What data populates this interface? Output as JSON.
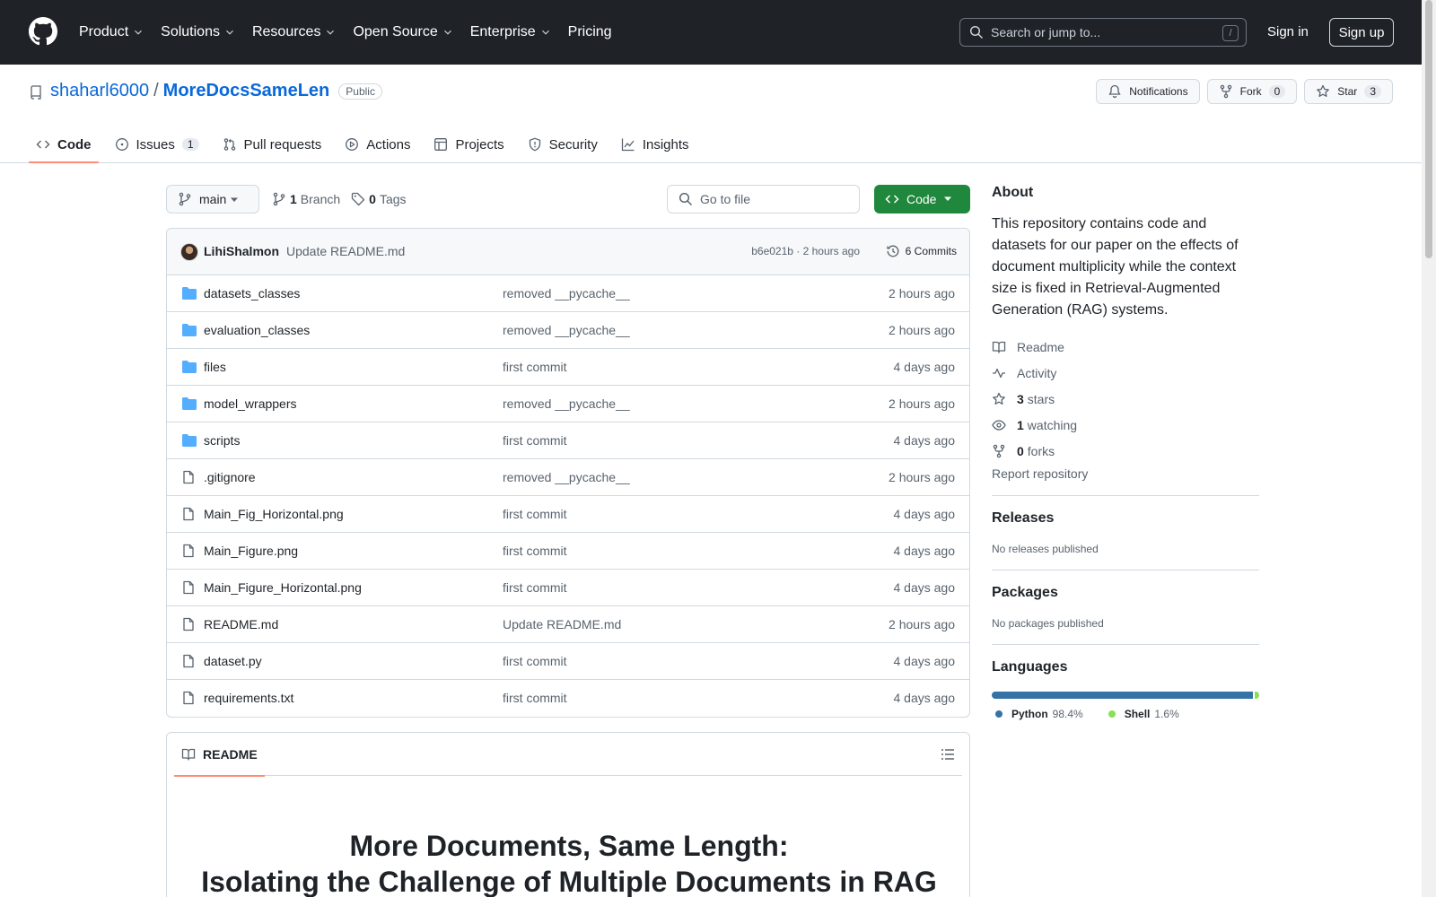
{
  "header": {
    "nav": [
      {
        "label": "Product",
        "dropdown": true
      },
      {
        "label": "Solutions",
        "dropdown": true
      },
      {
        "label": "Resources",
        "dropdown": true
      },
      {
        "label": "Open Source",
        "dropdown": true
      },
      {
        "label": "Enterprise",
        "dropdown": true
      },
      {
        "label": "Pricing",
        "dropdown": false
      }
    ],
    "search_placeholder": "Search or jump to...",
    "search_shortcut": "/",
    "sign_in": "Sign in",
    "sign_up": "Sign up"
  },
  "repo": {
    "owner": "shaharl6000",
    "separator": "/",
    "name": "MoreDocsSameLen",
    "visibility": "Public",
    "notifications_label": "Notifications",
    "fork_label": "Fork",
    "fork_count": "0",
    "star_label": "Star",
    "star_count": "3"
  },
  "tabs": [
    {
      "label": "Code",
      "icon": "code-icon",
      "active": true
    },
    {
      "label": "Issues",
      "icon": "issue-icon",
      "count": "1"
    },
    {
      "label": "Pull requests",
      "icon": "pull-request-icon"
    },
    {
      "label": "Actions",
      "icon": "play-icon"
    },
    {
      "label": "Projects",
      "icon": "table-icon"
    },
    {
      "label": "Security",
      "icon": "shield-icon"
    },
    {
      "label": "Insights",
      "icon": "graph-icon"
    }
  ],
  "filebar": {
    "branch": "main",
    "branch_count": "1",
    "branch_label": "Branch",
    "tag_count": "0",
    "tag_label": "Tags",
    "goto_placeholder": "Go to file",
    "code_button": "Code"
  },
  "latest_commit": {
    "author": "LihiShalmon",
    "message": "Update README.md",
    "meta": "b6e021b · 2 hours ago",
    "commits_label": "6 Commits"
  },
  "files": [
    {
      "type": "dir",
      "name": "datasets_classes",
      "message": "removed __pycache__",
      "age": "2 hours ago"
    },
    {
      "type": "dir",
      "name": "evaluation_classes",
      "message": "removed __pycache__",
      "age": "2 hours ago"
    },
    {
      "type": "dir",
      "name": "files",
      "message": "first commit",
      "age": "4 days ago"
    },
    {
      "type": "dir",
      "name": "model_wrappers",
      "message": "removed __pycache__",
      "age": "2 hours ago"
    },
    {
      "type": "dir",
      "name": "scripts",
      "message": "first commit",
      "age": "4 days ago"
    },
    {
      "type": "file",
      "name": ".gitignore",
      "message": "removed __pycache__",
      "age": "2 hours ago"
    },
    {
      "type": "file",
      "name": "Main_Fig_Horizontal.png",
      "message": "first commit",
      "age": "4 days ago"
    },
    {
      "type": "file",
      "name": "Main_Figure.png",
      "message": "first commit",
      "age": "4 days ago"
    },
    {
      "type": "file",
      "name": "Main_Figure_Horizontal.png",
      "message": "first commit",
      "age": "4 days ago"
    },
    {
      "type": "file",
      "name": "README.md",
      "message": "Update README.md",
      "age": "2 hours ago"
    },
    {
      "type": "file",
      "name": "dataset.py",
      "message": "first commit",
      "age": "4 days ago"
    },
    {
      "type": "file",
      "name": "requirements.txt",
      "message": "first commit",
      "age": "4 days ago"
    }
  ],
  "readme": {
    "tab_label": "README",
    "title_line1": "More Documents, Same Length:",
    "title_line2": "Isolating the Challenge of Multiple Documents in RAG"
  },
  "about": {
    "heading": "About",
    "description": "This repository contains code and datasets for our paper on the effects of document multiplicity while the context size is fixed in Retrieval-Augmented Generation (RAG) systems.",
    "readme_link": "Readme",
    "activity_link": "Activity",
    "stars_count": "3",
    "stars_label": "stars",
    "watching_count": "1",
    "watching_label": "watching",
    "forks_count": "0",
    "forks_label": "forks",
    "report": "Report repository"
  },
  "releases": {
    "heading": "Releases",
    "text": "No releases published"
  },
  "packages": {
    "heading": "Packages",
    "text": "No packages published"
  },
  "languages": {
    "heading": "Languages",
    "items": [
      {
        "name": "Python",
        "percent": "98.4%",
        "value": 98.4,
        "color": "#3572A5"
      },
      {
        "name": "Shell",
        "percent": "1.6%",
        "value": 1.6,
        "color": "#89e051"
      }
    ]
  },
  "colors": {
    "header_bg": "#1f2328",
    "link": "#0969da",
    "primary_button": "#1f883d",
    "active_tab_underline": "#fd8c73"
  }
}
